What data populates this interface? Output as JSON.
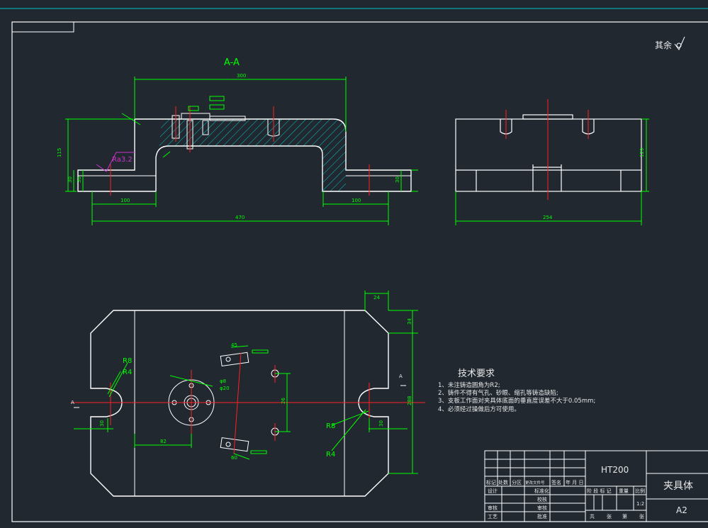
{
  "section_label": "A-A",
  "surface_note": "其余",
  "roughness_note": "Ra3.2",
  "dimensions": {
    "top_width": "300",
    "overall_length": "470",
    "left_foot": "100",
    "right_foot": "100",
    "height_total": "115",
    "left_foot_h1": "30",
    "left_foot_h2": "30",
    "right_foot_h": "30",
    "side_width": "254",
    "side_height": "129",
    "plan_r1": "R8",
    "plan_r2": "R4",
    "plan_r3": "R8",
    "plan_r4": "R4",
    "plan_top_w": "24",
    "plan_side_a": "34",
    "plan_height": "288",
    "plan_left_slot": "30",
    "plan_right_slot": "30",
    "plan_center_off": "82",
    "plan_holes": "26",
    "small_45": "45",
    "small_60": "60",
    "small_a": "φ8",
    "small_b": "φ20"
  },
  "tech": {
    "title": "技术要求",
    "lines": [
      "1、未注铸造圆角为R2;",
      "2、铸件不得有气孔、砂眼、缩孔等铸造缺陷;",
      "3、支板工作面对夹具体底面的垂直度误差不大于0.05mm;",
      "4、必须经过操做后方可使用。"
    ]
  },
  "title_block": {
    "material": "HT200",
    "name": "夹具体",
    "sheet_size": "A2",
    "scale": "1:2",
    "row1": [
      "标记",
      "处数",
      "分区",
      "更改文件号",
      "签名",
      "年 月 日"
    ],
    "row2": [
      "设计",
      "",
      "",
      "标准化",
      "",
      ""
    ],
    "row3": [
      "审核",
      "",
      "",
      "",
      "",
      ""
    ],
    "row4": [
      "工艺",
      "",
      "",
      "批准",
      "",
      ""
    ],
    "std_sub": [
      "阶 段 标 记",
      "重量",
      "比例"
    ],
    "sheet_row": [
      "共",
      "张",
      "第",
      "张"
    ],
    "review": "审核",
    "check": "校核"
  },
  "section_marks": [
    "A",
    "A"
  ],
  "colors": {
    "background": "#212830",
    "outline": "#ffffff",
    "dimension": "#00ff00",
    "centerline": "#ff2020",
    "hatch": "#00c8c8",
    "roughness": "#cc33cc",
    "frame": "#ffffff"
  }
}
